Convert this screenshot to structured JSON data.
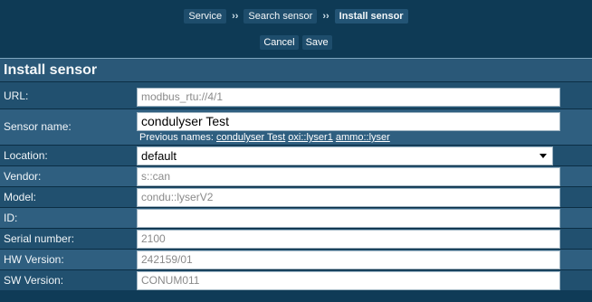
{
  "breadcrumb": {
    "items": [
      "Service",
      "Search sensor",
      "Install sensor"
    ],
    "separator": "››"
  },
  "actions": {
    "cancel": "Cancel",
    "save": "Save"
  },
  "section": {
    "title": "Install sensor"
  },
  "form": {
    "url": {
      "label": "URL:",
      "value": "modbus_rtu://4/1"
    },
    "sensor_name": {
      "label": "Sensor name:",
      "value": "condulyser Test",
      "previous_prefix": "Previous names:",
      "previous_names": [
        "condulyser Test",
        "oxi::lyser1",
        "ammo::lyser"
      ]
    },
    "location": {
      "label": "Location:",
      "value": "default"
    },
    "vendor": {
      "label": "Vendor:",
      "value": "s::can"
    },
    "model": {
      "label": "Model:",
      "value": "condu::lyserV2"
    },
    "id": {
      "label": "ID:",
      "value": ""
    },
    "serial": {
      "label": "Serial number:",
      "value": "2100"
    },
    "hw": {
      "label": "HW Version:",
      "value": "242159/01"
    },
    "sw": {
      "label": "SW Version:",
      "value": "CONUM011"
    }
  },
  "colors": {
    "background": "#0f3b57",
    "row_dark": "#21506f",
    "row_light": "#2f5f80",
    "section": "#2a5878"
  }
}
